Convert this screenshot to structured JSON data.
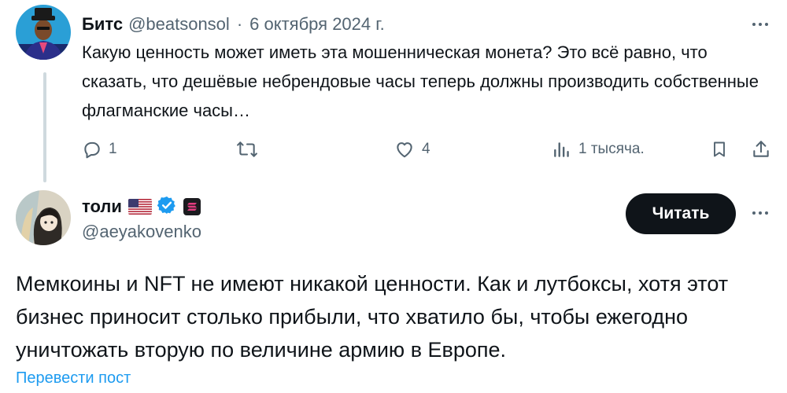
{
  "tweet1": {
    "name": "Битс",
    "handle": "@beatsonsol",
    "separator": "·",
    "date": "6 октября 2024 г.",
    "text": "Какую ценность может иметь эта мошенническая монета? Это всё равно, что сказать, что дешёвые небрендовые часы теперь должны производить собственные флагманские часы…",
    "actions": {
      "reply_count": "1",
      "retweet_count": "",
      "like_count": "4",
      "views_count": "1 тысяча."
    },
    "icons": [
      "avatar",
      "more-icon",
      "reply-icon",
      "retweet-icon",
      "like-icon",
      "views-icon",
      "bookmark-icon",
      "share-icon"
    ]
  },
  "tweet2": {
    "name": "толи",
    "handle": "@aeyakovenko",
    "badges": [
      "us-flag-icon",
      "verified-icon",
      "solana-icon"
    ],
    "read_button": "Читать",
    "text": "Мемкоины и NFT не имеют никакой ценности. Как и лутбоксы, хотя этот бизнес приносит столько прибыли, что хватило бы, чтобы ежегодно уничтожать вторую по величине армию в Европе.",
    "translate_link": "Перевести пост"
  },
  "colors": {
    "text_primary": "#0f1419",
    "text_secondary": "#536471",
    "link": "#1d9bf0",
    "verified": "#1d9bf0",
    "thread_line": "#cfd9de",
    "button_bg": "#0f1419"
  }
}
